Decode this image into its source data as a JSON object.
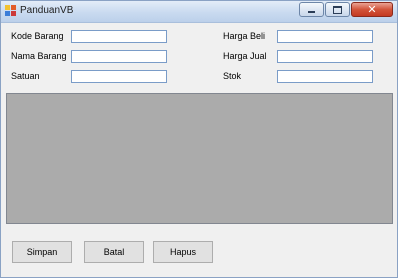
{
  "window": {
    "title": "PanduanVB",
    "minimize_icon": "minimize-icon",
    "maximize_icon": "maximize-icon",
    "close_glyph": "✕"
  },
  "form": {
    "kode_barang": {
      "label": "Kode Barang",
      "value": ""
    },
    "nama_barang": {
      "label": "Nama Barang",
      "value": ""
    },
    "satuan": {
      "label": "Satuan",
      "value": ""
    },
    "harga_beli": {
      "label": "Harga Beli",
      "value": ""
    },
    "harga_jual": {
      "label": "Harga Jual",
      "value": ""
    },
    "stok": {
      "label": "Stok",
      "value": ""
    }
  },
  "buttons": {
    "simpan": "Simpan",
    "batal": "Batal",
    "hapus": "Hapus"
  },
  "colors": {
    "grid_background": "#ababab",
    "window_background": "#f0f0f0",
    "close_button": "#c43a22"
  }
}
